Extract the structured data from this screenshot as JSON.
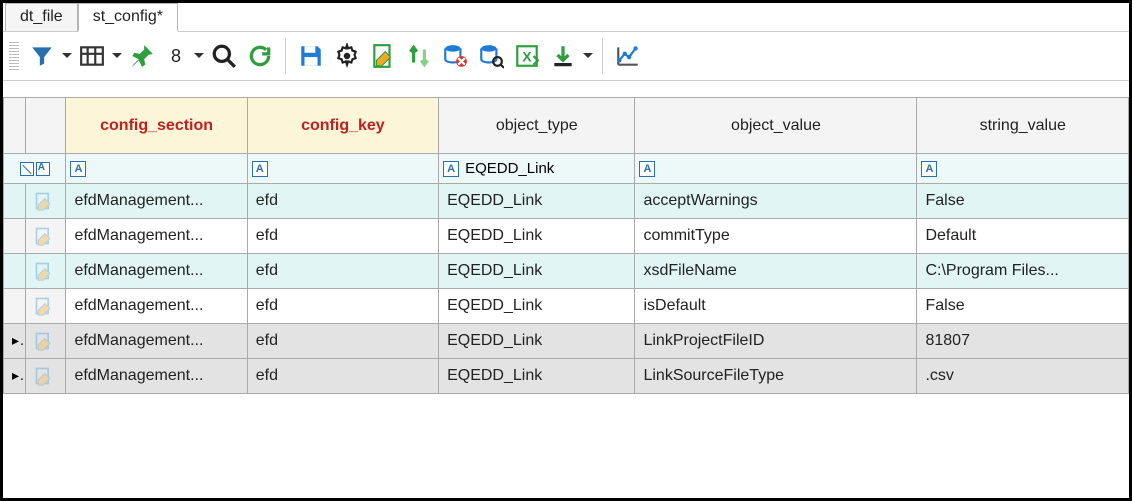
{
  "tabs": [
    {
      "label": "dt_file"
    },
    {
      "label": "st_config*"
    }
  ],
  "toolbar": {
    "row_count": "8"
  },
  "columns": {
    "config_section": "config_section",
    "config_key": "config_key",
    "object_type": "object_type",
    "object_value": "object_value",
    "string_value": "string_value"
  },
  "filter": {
    "config_section": "",
    "config_key": "",
    "object_type": "EQEDD_Link",
    "object_value": "",
    "string_value": ""
  },
  "rows": [
    {
      "config_section": "efdManagement...",
      "config_key": "efd",
      "object_type": "EQEDD_Link",
      "object_value": "acceptWarnings",
      "string_value": "False",
      "hl": true
    },
    {
      "config_section": "efdManagement...",
      "config_key": "efd",
      "object_type": "EQEDD_Link",
      "object_value": "commitType",
      "string_value": "Default"
    },
    {
      "config_section": "efdManagement...",
      "config_key": "efd",
      "object_type": "EQEDD_Link",
      "object_value": "xsdFileName",
      "string_value": "C:\\Program Files...",
      "hl": true
    },
    {
      "config_section": "efdManagement...",
      "config_key": "efd",
      "object_type": "EQEDD_Link",
      "object_value": "isDefault",
      "string_value": "False"
    },
    {
      "config_section": "efdManagement...",
      "config_key": "efd",
      "object_type": "EQEDD_Link",
      "object_value": "LinkProjectFileID",
      "string_value": "81807",
      "sel": true
    },
    {
      "config_section": "efdManagement...",
      "config_key": "efd",
      "object_type": "EQEDD_Link",
      "object_value": "LinkSourceFileType",
      "string_value": ".csv",
      "sel": true
    }
  ]
}
